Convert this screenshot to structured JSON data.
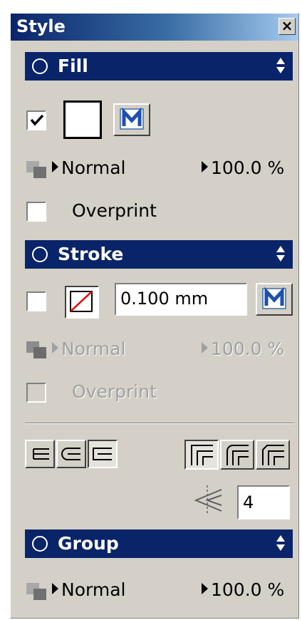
{
  "window": {
    "title": "Style",
    "close_glyph": "×"
  },
  "fill": {
    "header": "Fill",
    "enabled": true,
    "blend_mode": "Normal",
    "opacity": "100.0 %",
    "overprint_label": "Overprint",
    "overprint_checked": false
  },
  "stroke": {
    "header": "Stroke",
    "enabled": false,
    "width_value": "0.100 mm",
    "blend_mode": "Normal",
    "opacity": "100.0 %",
    "overprint_label": "Overprint",
    "overprint_checked": false
  },
  "miter": {
    "value": "4"
  },
  "group": {
    "header": "Group",
    "blend_mode": "Normal",
    "opacity": "100.0 %"
  },
  "colors": {
    "titlebar_start": "#0a246a",
    "section_header": "#0a246a",
    "panel_bg": "#d4d0c8",
    "disabled_text": "#a0a0a0"
  },
  "icons": {
    "color_model": "m-icon",
    "blend": "overlap-squares-icon",
    "no_color": "no-color-icon",
    "caps": [
      "butt-cap-icon",
      "round-cap-icon",
      "square-cap-icon"
    ],
    "joins": [
      "miter-join-icon",
      "round-join-icon",
      "bevel-join-icon"
    ],
    "miter": "miter-limit-icon"
  }
}
